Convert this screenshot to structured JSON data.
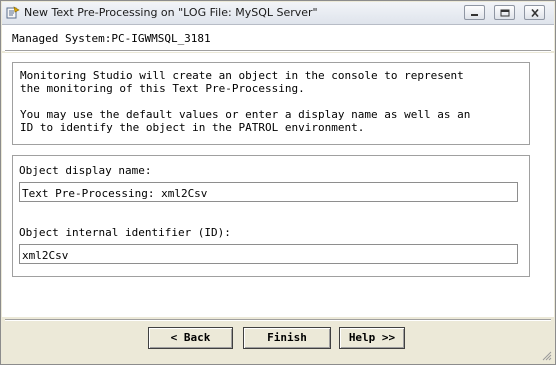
{
  "window": {
    "title": "New Text Pre-Processing on \"LOG File: MySQL Server\"",
    "icons": {
      "app": "patrol-app-icon",
      "minimize": "minimize-icon",
      "maximize": "maximize-icon",
      "close": "close-icon"
    }
  },
  "header": {
    "managed_system": "Managed System:PC-IGWMSQL_3181"
  },
  "info": {
    "paragraph1": "Monitoring Studio will create an object in the console to represent\nthe monitoring of this Text Pre-Processing.",
    "paragraph2": "You may use the default values or enter a display name as well as an\nID to identify the object in the PATROL environment."
  },
  "fields": {
    "display_name_label": "Object display name:",
    "display_name_value": "Text Pre-Processing: xml2Csv",
    "id_label": "Object internal identifier (ID):",
    "id_value": "xml2Csv"
  },
  "buttons": {
    "back": "< Back",
    "finish": "Finish",
    "help": "Help >>"
  },
  "colors": {
    "dialog_bg": "#ece9d8",
    "content_bg": "#ffffff",
    "border": "#a0a0a0"
  }
}
